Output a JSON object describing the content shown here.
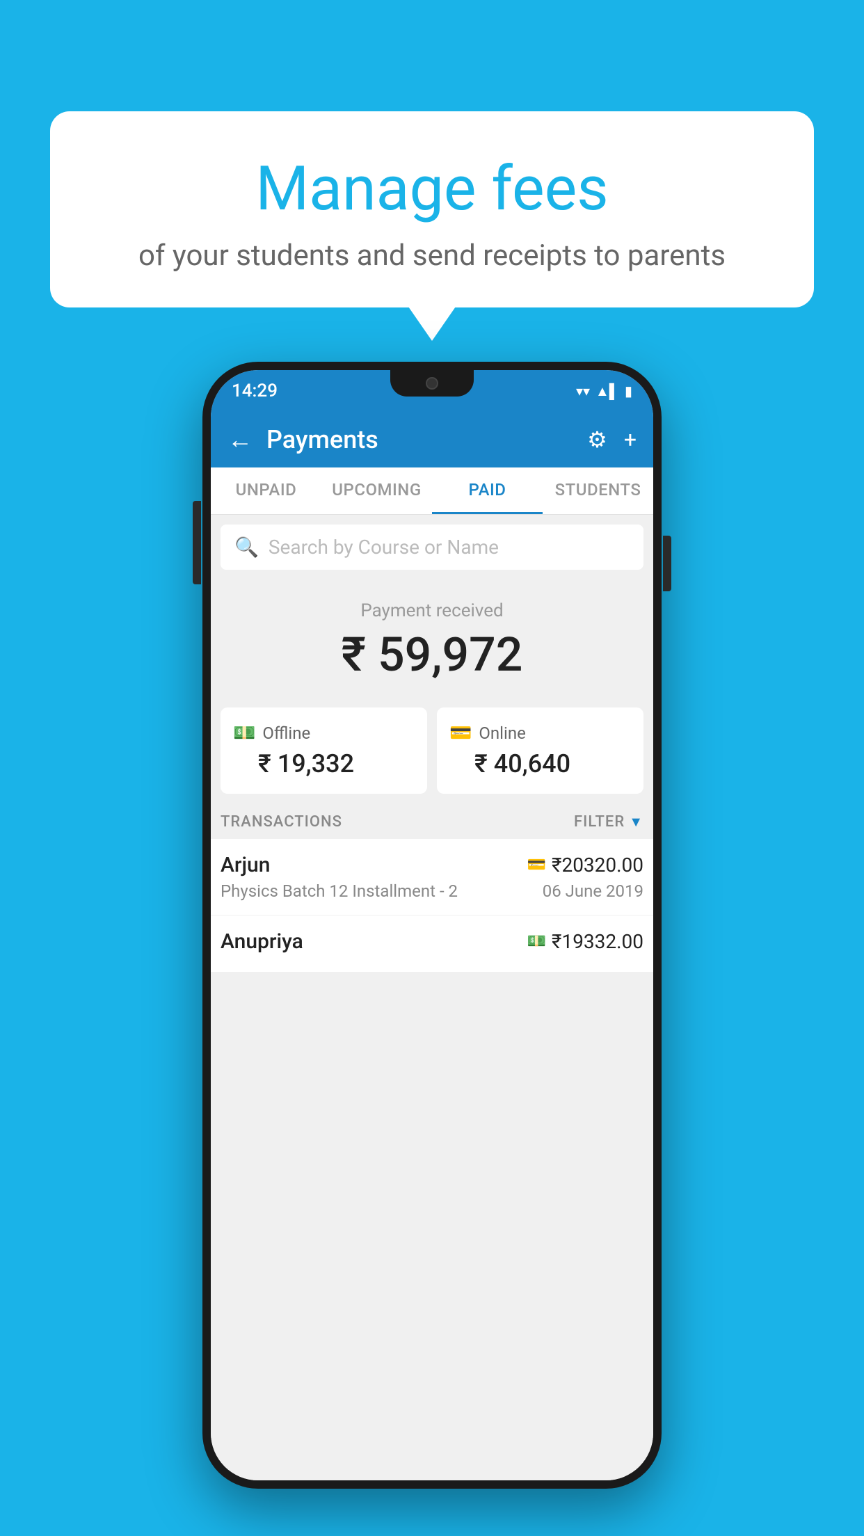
{
  "background_color": "#1ab3e8",
  "speech_bubble": {
    "title": "Manage fees",
    "subtitle": "of your students and send receipts to parents"
  },
  "status_bar": {
    "time": "14:29",
    "wifi": "▼",
    "signal": "▲",
    "battery": "▮"
  },
  "header": {
    "title": "Payments",
    "back_label": "←",
    "gear_label": "⚙",
    "plus_label": "+"
  },
  "tabs": [
    {
      "id": "unpaid",
      "label": "UNPAID",
      "active": false
    },
    {
      "id": "upcoming",
      "label": "UPCOMING",
      "active": false
    },
    {
      "id": "paid",
      "label": "PAID",
      "active": true
    },
    {
      "id": "students",
      "label": "STUDENTS",
      "active": false
    }
  ],
  "search": {
    "placeholder": "Search by Course or Name"
  },
  "payment_summary": {
    "label": "Payment received",
    "amount": "₹ 59,972"
  },
  "cards": [
    {
      "id": "offline",
      "mode": "Offline",
      "icon": "💳",
      "amount": "₹ 19,332"
    },
    {
      "id": "online",
      "mode": "Online",
      "icon": "💳",
      "amount": "₹ 40,640"
    }
  ],
  "transactions_section": {
    "label": "TRANSACTIONS",
    "filter_label": "FILTER"
  },
  "transactions": [
    {
      "name": "Arjun",
      "course": "Physics Batch 12 Installment - 2",
      "amount": "₹20320.00",
      "date": "06 June 2019",
      "mode_icon": "card"
    },
    {
      "name": "Anupriya",
      "course": "",
      "amount": "₹19332.00",
      "date": "",
      "mode_icon": "cash"
    }
  ]
}
